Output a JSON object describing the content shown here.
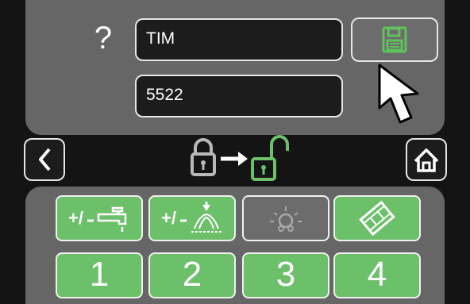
{
  "form": {
    "help_label": "?",
    "username_value": "TIM",
    "pin_value": "5522"
  },
  "toolbar": {
    "save_icon": "floppy-disk-icon",
    "back_icon": "chevron-left-icon",
    "home_icon": "home-icon"
  },
  "lock_transition": {
    "from_icon": "lock-closed-icon",
    "arrow_icon": "arrow-right-icon",
    "to_icon": "lock-open-icon"
  },
  "function_tiles": [
    {
      "icon": "water-tap-plus-minus-icon",
      "state": "active"
    },
    {
      "icon": "spray-plus-minus-icon",
      "state": "active"
    },
    {
      "icon": "light-bulb-icon",
      "state": "inactive"
    },
    {
      "icon": "film-icon",
      "state": "active"
    }
  ],
  "number_tiles": [
    "1",
    "2",
    "3",
    "4"
  ],
  "colors": {
    "accent_green": "#6cc06a",
    "panel_grey": "#666666",
    "background": "#141414"
  }
}
